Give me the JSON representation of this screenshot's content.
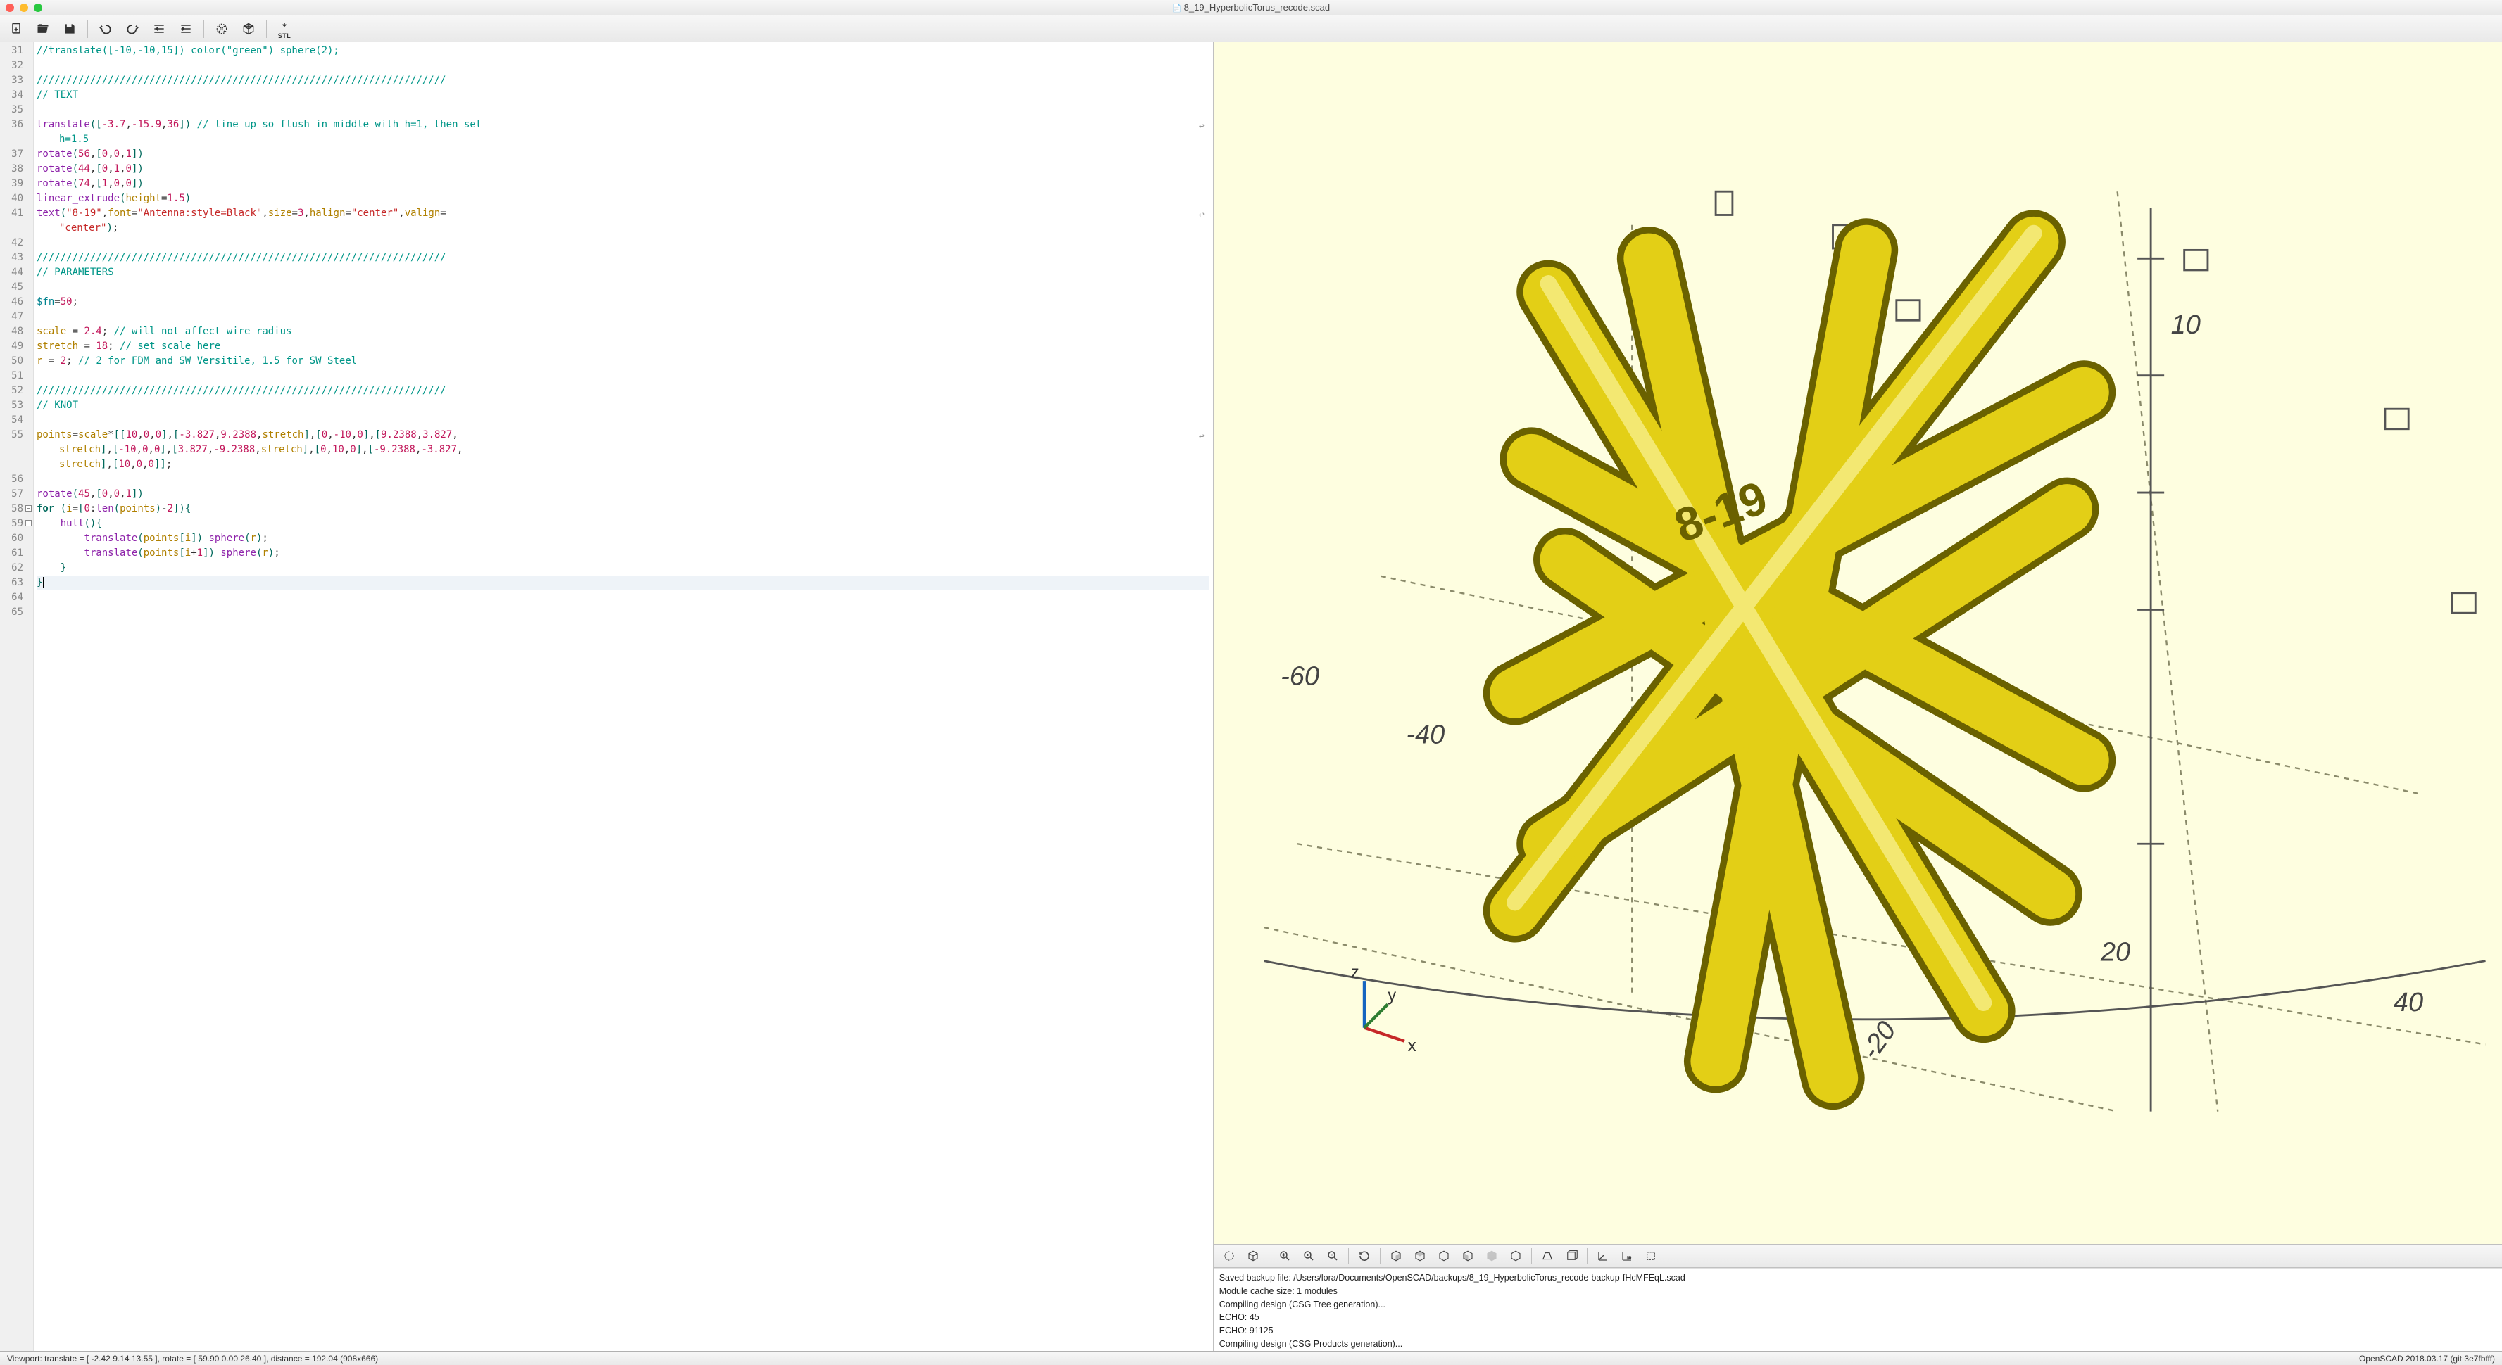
{
  "window": {
    "title": "8_19_HyperbolicTorus_recode.scad"
  },
  "editor": {
    "first_line": 31,
    "last_line": 65,
    "current_line": 63,
    "fold_lines": [
      58,
      59
    ],
    "wrap_lines": [
      36,
      41,
      55
    ],
    "lines": {
      "31": [
        [
          "//translate([-10,-10,15]) color(\"green\") sphere(2);",
          "comment"
        ]
      ],
      "32": [],
      "33": [
        [
          "/////////////////////////////////////////////////////////////////////",
          "comment"
        ]
      ],
      "34": [
        [
          "// TEXT",
          "comment"
        ]
      ],
      "35": [],
      "36": [
        [
          "translate",
          "func"
        ],
        [
          "(",
          "paren"
        ],
        [
          "[",
          "bracket"
        ],
        [
          "-3.7",
          "num"
        ],
        [
          ",",
          "punct"
        ],
        [
          "-15.9",
          "num"
        ],
        [
          ",",
          "punct"
        ],
        [
          "36",
          "num"
        ],
        [
          "]",
          "bracket"
        ],
        [
          ")",
          "paren"
        ],
        [
          " ",
          ""
        ],
        [
          "// line up so flush in middle with h=1, then set",
          "comment"
        ]
      ],
      "36b": [
        [
          "h=1.5",
          "comment"
        ]
      ],
      "37": [
        [
          "rotate",
          "func"
        ],
        [
          "(",
          "paren"
        ],
        [
          "56",
          "num"
        ],
        [
          ",",
          "punct"
        ],
        [
          "[",
          "bracket"
        ],
        [
          "0",
          "num"
        ],
        [
          ",",
          "punct"
        ],
        [
          "0",
          "num"
        ],
        [
          ",",
          "punct"
        ],
        [
          "1",
          "num"
        ],
        [
          "]",
          "bracket"
        ],
        [
          ")",
          "paren"
        ]
      ],
      "38": [
        [
          "rotate",
          "func"
        ],
        [
          "(",
          "paren"
        ],
        [
          "44",
          "num"
        ],
        [
          ",",
          "punct"
        ],
        [
          "[",
          "bracket"
        ],
        [
          "0",
          "num"
        ],
        [
          ",",
          "punct"
        ],
        [
          "1",
          "num"
        ],
        [
          ",",
          "punct"
        ],
        [
          "0",
          "num"
        ],
        [
          "]",
          "bracket"
        ],
        [
          ")",
          "paren"
        ]
      ],
      "39": [
        [
          "rotate",
          "func"
        ],
        [
          "(",
          "paren"
        ],
        [
          "74",
          "num"
        ],
        [
          ",",
          "punct"
        ],
        [
          "[",
          "bracket"
        ],
        [
          "1",
          "num"
        ],
        [
          ",",
          "punct"
        ],
        [
          "0",
          "num"
        ],
        [
          ",",
          "punct"
        ],
        [
          "0",
          "num"
        ],
        [
          "]",
          "bracket"
        ],
        [
          ")",
          "paren"
        ]
      ],
      "40": [
        [
          "linear_extrude",
          "func"
        ],
        [
          "(",
          "paren"
        ],
        [
          "height",
          "var"
        ],
        [
          "=",
          "punct"
        ],
        [
          "1.5",
          "num"
        ],
        [
          ")",
          "paren"
        ]
      ],
      "41": [
        [
          "text",
          "func"
        ],
        [
          "(",
          "paren"
        ],
        [
          "\"8-19\"",
          "str"
        ],
        [
          ",",
          "punct"
        ],
        [
          "font",
          "var"
        ],
        [
          "=",
          "punct"
        ],
        [
          "\"Antenna:style=Black\"",
          "str"
        ],
        [
          ",",
          "punct"
        ],
        [
          "size",
          "var"
        ],
        [
          "=",
          "punct"
        ],
        [
          "3",
          "num"
        ],
        [
          ",",
          "punct"
        ],
        [
          "halign",
          "var"
        ],
        [
          "=",
          "punct"
        ],
        [
          "\"center\"",
          "str"
        ],
        [
          ",",
          "punct"
        ],
        [
          "valign",
          "var"
        ],
        [
          "=",
          "punct"
        ]
      ],
      "41b": [
        [
          "\"center\"",
          "str"
        ],
        [
          ")",
          "paren"
        ],
        [
          ";",
          "punct"
        ]
      ],
      "42": [],
      "43": [
        [
          "/////////////////////////////////////////////////////////////////////",
          "comment"
        ]
      ],
      "44": [
        [
          "// PARAMETERS",
          "comment"
        ]
      ],
      "45": [],
      "46": [
        [
          "$fn",
          "keyword"
        ],
        [
          "=",
          "punct"
        ],
        [
          "50",
          "num"
        ],
        [
          ";",
          "punct"
        ]
      ],
      "47": [],
      "48": [
        [
          "scale",
          "var"
        ],
        [
          " = ",
          "punct"
        ],
        [
          "2.4",
          "num"
        ],
        [
          "; ",
          "punct"
        ],
        [
          "// will not affect wire radius",
          "comment"
        ]
      ],
      "49": [
        [
          "stretch",
          "var"
        ],
        [
          " = ",
          "punct"
        ],
        [
          "18",
          "num"
        ],
        [
          "; ",
          "punct"
        ],
        [
          "// set scale here",
          "comment"
        ]
      ],
      "50": [
        [
          "r",
          "var"
        ],
        [
          " = ",
          "punct"
        ],
        [
          "2",
          "num"
        ],
        [
          "; ",
          "punct"
        ],
        [
          "// 2 for FDM and SW Versitile, 1.5 for SW Steel",
          "comment"
        ]
      ],
      "51": [],
      "52": [
        [
          "/////////////////////////////////////////////////////////////////////",
          "comment"
        ]
      ],
      "53": [
        [
          "// KNOT",
          "comment"
        ]
      ],
      "54": [],
      "55": [
        [
          "points",
          "var"
        ],
        [
          "=",
          "punct"
        ],
        [
          "scale",
          "var"
        ],
        [
          "*",
          "punct"
        ],
        [
          "[",
          "bracket"
        ],
        [
          "[",
          "bracket"
        ],
        [
          "10",
          "num"
        ],
        [
          ",",
          "punct"
        ],
        [
          "0",
          "num"
        ],
        [
          ",",
          "punct"
        ],
        [
          "0",
          "num"
        ],
        [
          "]",
          "bracket"
        ],
        [
          ",",
          "punct"
        ],
        [
          "[",
          "bracket"
        ],
        [
          "-3.827",
          "num"
        ],
        [
          ",",
          "punct"
        ],
        [
          "9.2388",
          "num"
        ],
        [
          ",",
          "punct"
        ],
        [
          "stretch",
          "var"
        ],
        [
          "]",
          "bracket"
        ],
        [
          ",",
          "punct"
        ],
        [
          "[",
          "bracket"
        ],
        [
          "0",
          "num"
        ],
        [
          ",",
          "punct"
        ],
        [
          "-10",
          "num"
        ],
        [
          ",",
          "punct"
        ],
        [
          "0",
          "num"
        ],
        [
          "]",
          "bracket"
        ],
        [
          ",",
          "punct"
        ],
        [
          "[",
          "bracket"
        ],
        [
          "9.2388",
          "num"
        ],
        [
          ",",
          "punct"
        ],
        [
          "3.827",
          "num"
        ],
        [
          ",",
          "punct"
        ]
      ],
      "55b": [
        [
          "stretch",
          "var"
        ],
        [
          "]",
          "bracket"
        ],
        [
          ",",
          "punct"
        ],
        [
          "[",
          "bracket"
        ],
        [
          "-10",
          "num"
        ],
        [
          ",",
          "punct"
        ],
        [
          "0",
          "num"
        ],
        [
          ",",
          "punct"
        ],
        [
          "0",
          "num"
        ],
        [
          "]",
          "bracket"
        ],
        [
          ",",
          "punct"
        ],
        [
          "[",
          "bracket"
        ],
        [
          "3.827",
          "num"
        ],
        [
          ",",
          "punct"
        ],
        [
          "-9.2388",
          "num"
        ],
        [
          ",",
          "punct"
        ],
        [
          "stretch",
          "var"
        ],
        [
          "]",
          "bracket"
        ],
        [
          ",",
          "punct"
        ],
        [
          "[",
          "bracket"
        ],
        [
          "0",
          "num"
        ],
        [
          ",",
          "punct"
        ],
        [
          "10",
          "num"
        ],
        [
          ",",
          "punct"
        ],
        [
          "0",
          "num"
        ],
        [
          "]",
          "bracket"
        ],
        [
          ",",
          "punct"
        ],
        [
          "[",
          "bracket"
        ],
        [
          "-9.2388",
          "num"
        ],
        [
          ",",
          "punct"
        ],
        [
          "-3.827",
          "num"
        ],
        [
          ",",
          "punct"
        ]
      ],
      "55c": [
        [
          "stretch",
          "var"
        ],
        [
          "]",
          "bracket"
        ],
        [
          ",",
          "punct"
        ],
        [
          "[",
          "bracket"
        ],
        [
          "10",
          "num"
        ],
        [
          ",",
          "punct"
        ],
        [
          "0",
          "num"
        ],
        [
          ",",
          "punct"
        ],
        [
          "0",
          "num"
        ],
        [
          "]",
          "bracket"
        ],
        [
          "]",
          "bracket"
        ],
        [
          ";",
          "punct"
        ]
      ],
      "56": [],
      "57": [
        [
          "rotate",
          "func"
        ],
        [
          "(",
          "paren"
        ],
        [
          "45",
          "num"
        ],
        [
          ",",
          "punct"
        ],
        [
          "[",
          "bracket"
        ],
        [
          "0",
          "num"
        ],
        [
          ",",
          "punct"
        ],
        [
          "0",
          "num"
        ],
        [
          ",",
          "punct"
        ],
        [
          "1",
          "num"
        ],
        [
          "]",
          "bracket"
        ],
        [
          ")",
          "paren"
        ]
      ],
      "58": [
        [
          "for",
          "for"
        ],
        [
          " (",
          "paren"
        ],
        [
          "i",
          "var"
        ],
        [
          "=",
          "punct"
        ],
        [
          "[",
          "bracket"
        ],
        [
          "0",
          "num"
        ],
        [
          ":",
          "punct"
        ],
        [
          "len",
          "func"
        ],
        [
          "(",
          "paren"
        ],
        [
          "points",
          "var"
        ],
        [
          ")",
          "paren"
        ],
        [
          "-",
          "punct"
        ],
        [
          "2",
          "num"
        ],
        [
          "]",
          "bracket"
        ],
        [
          ")",
          "paren"
        ],
        [
          "{",
          "paren"
        ]
      ],
      "59": [
        [
          "    ",
          ""
        ],
        [
          "hull",
          "func"
        ],
        [
          "(",
          "paren"
        ],
        [
          ")",
          "paren"
        ],
        [
          "{",
          "paren"
        ]
      ],
      "60": [
        [
          "        ",
          ""
        ],
        [
          "translate",
          "func"
        ],
        [
          "(",
          "paren"
        ],
        [
          "points",
          "var"
        ],
        [
          "[",
          "bracket"
        ],
        [
          "i",
          "var"
        ],
        [
          "]",
          "bracket"
        ],
        [
          ")",
          "paren"
        ],
        [
          " ",
          ""
        ],
        [
          "sphere",
          "func"
        ],
        [
          "(",
          "paren"
        ],
        [
          "r",
          "var"
        ],
        [
          ")",
          "paren"
        ],
        [
          ";",
          "punct"
        ]
      ],
      "61": [
        [
          "        ",
          ""
        ],
        [
          "translate",
          "func"
        ],
        [
          "(",
          "paren"
        ],
        [
          "points",
          "var"
        ],
        [
          "[",
          "bracket"
        ],
        [
          "i",
          "var"
        ],
        [
          "+",
          "punct"
        ],
        [
          "1",
          "num"
        ],
        [
          "]",
          "bracket"
        ],
        [
          ")",
          "paren"
        ],
        [
          " ",
          ""
        ],
        [
          "sphere",
          "func"
        ],
        [
          "(",
          "paren"
        ],
        [
          "r",
          "var"
        ],
        [
          ")",
          "paren"
        ],
        [
          ";",
          "punct"
        ]
      ],
      "62": [
        [
          "    }",
          "paren"
        ]
      ],
      "63": [
        [
          "}",
          "paren"
        ]
      ],
      "64": [],
      "65": []
    }
  },
  "console": {
    "lines": [
      "Saved backup file: /Users/lora/Documents/OpenSCAD/backups/8_19_HyperbolicTorus_recode-backup-fHcMFEqL.scad",
      "Module cache size: 1 modules",
      "Compiling design (CSG Tree generation)...",
      "ECHO: 45",
      "ECHO: 91125",
      "Compiling design (CSG Products generation)..."
    ]
  },
  "status": {
    "left": "Viewport: translate = [ -2.42 9.14 13.55 ], rotate = [ 59.90 0.00 26.40 ], distance = 192.04 (908x666)",
    "right": "OpenSCAD 2018.03.17 (git 3e7fbfff)"
  },
  "viewport": {
    "knot_label": "8-19",
    "axis_ticks": [
      "-60",
      "-40",
      "-20",
      "20",
      "40",
      "10"
    ]
  }
}
